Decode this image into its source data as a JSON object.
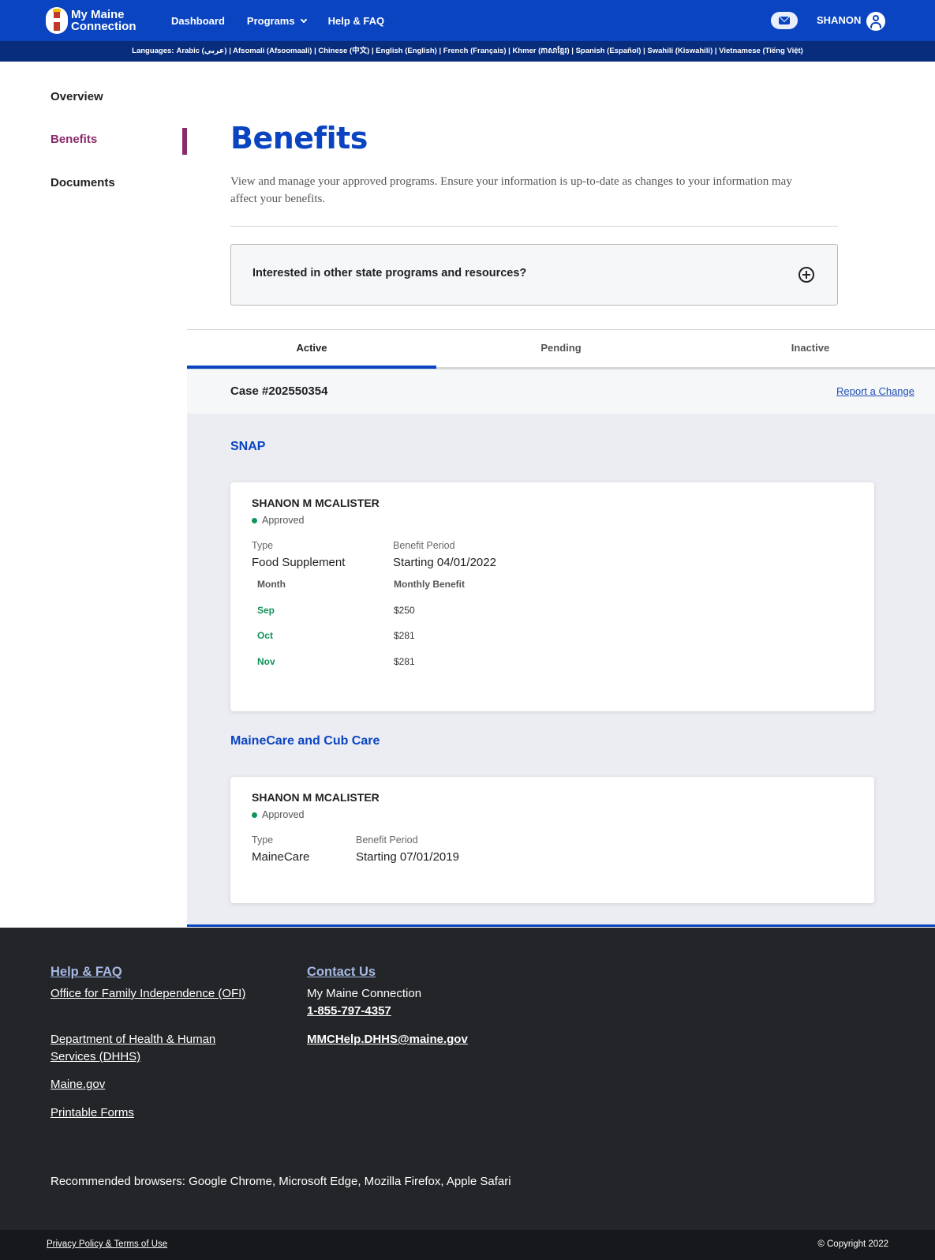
{
  "header": {
    "logo_line1": "My Maine",
    "logo_line2": "Connection",
    "nav": [
      "Dashboard",
      "Programs",
      "Help & FAQ"
    ],
    "user_name": "SHANON"
  },
  "languages": {
    "label": "Languages:",
    "text": "Arabic (عربي) | Afsomali (Afsoomaali) | Chinese (中文) | English (English) | French (Français) | Khmer (ភាសាខ្មែរ) | Spanish (Español) | Swahili (Kiswahili) | Vietnamese (Tiếng Việt)"
  },
  "sidebar": {
    "items": [
      "Overview",
      "Benefits",
      "Documents"
    ],
    "active": "Benefits"
  },
  "page": {
    "title": "Benefits",
    "intro": "View and manage your approved programs. Ensure your information is up-to-date as changes to your information may affect your benefits.",
    "accordion_question": "Interested in other state programs and resources?"
  },
  "tabs": [
    "Active",
    "Pending",
    "Inactive"
  ],
  "case": {
    "number": "Case #202550354",
    "report_link": "Report a Change"
  },
  "programs": [
    {
      "title": "SNAP",
      "name": "SHANON M MCALISTER",
      "status": "Approved",
      "type_label": "Type",
      "type_value": "Food Supplement",
      "period_label": "Benefit Period",
      "period_value": "Starting 04/01/2022",
      "table_headers": [
        "Month",
        "Monthly Benefit"
      ],
      "rows": [
        {
          "month": "Sep",
          "amount": "$250"
        },
        {
          "month": "Oct",
          "amount": "$281"
        },
        {
          "month": "Nov",
          "amount": "$281"
        }
      ]
    },
    {
      "title": "MaineCare and Cub Care",
      "name": "SHANON M MCALISTER",
      "status": "Approved",
      "type_label": "Type",
      "type_value": "MaineCare",
      "period_label": "Benefit Period",
      "period_value": "Starting 07/01/2019"
    }
  ],
  "footer": {
    "help_heading": "Help & FAQ",
    "help_links": [
      "Office for Family Independence (OFI)",
      "Department of Health & Human Services (DHHS)",
      "Maine.gov",
      "Printable Forms"
    ],
    "contact_heading": "Contact Us",
    "contact_name": "My Maine Connection",
    "contact_phone": "1-855-797-4357",
    "contact_email": "MMCHelp.DHHS@maine.gov",
    "browsers": "Recommended browsers: Google Chrome, Microsoft Edge, Mozilla Firefox, Apple Safari",
    "privacy": "Privacy Policy & Terms of Use",
    "copyright": "© Copyright 2022"
  },
  "colors": {
    "brand_blue": "#0a44c0",
    "language_bar": "#082d7d",
    "active_nav": "#8a2a6b",
    "approved_green": "#12935a",
    "footer_bg": "#232529"
  }
}
